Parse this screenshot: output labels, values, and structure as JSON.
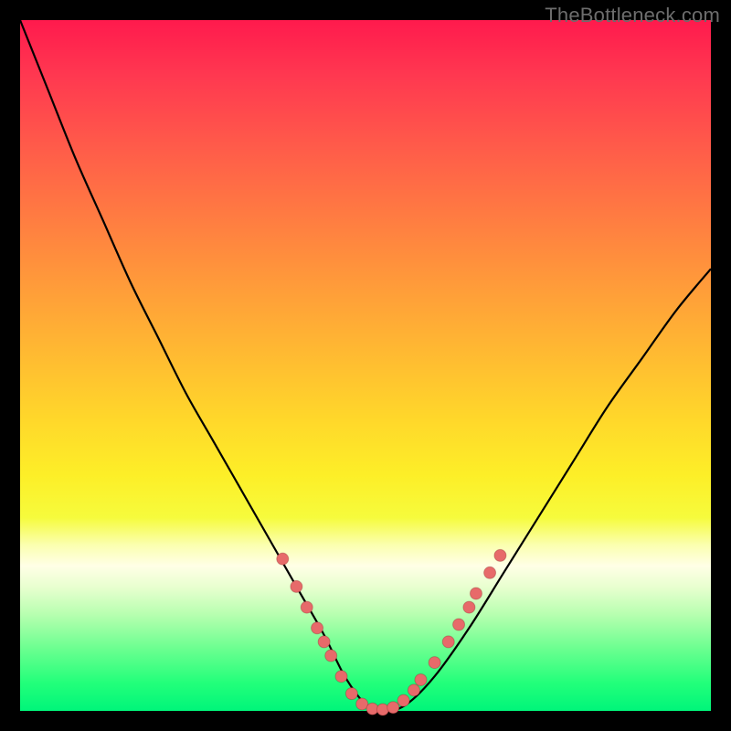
{
  "watermark": "TheBottleneck.com",
  "colors": {
    "curve": "#000000",
    "dots": "#e76a6a",
    "frame_bg_top": "#ff1a4d",
    "frame_bg_bottom": "#00f57a",
    "page_bg": "#000000"
  },
  "chart_data": {
    "type": "line",
    "title": "",
    "xlabel": "",
    "ylabel": "",
    "xlim": [
      0,
      100
    ],
    "ylim": [
      0,
      100
    ],
    "note": "Values estimated from pixel positions; axes have no tick labels.",
    "series": [
      {
        "name": "bottleneck-curve",
        "x": [
          0,
          4,
          8,
          12,
          16,
          20,
          24,
          28,
          32,
          36,
          40,
          44,
          47,
          50,
          53,
          56,
          60,
          65,
          70,
          75,
          80,
          85,
          90,
          95,
          100
        ],
        "y": [
          100,
          90,
          80,
          71,
          62,
          54,
          46,
          39,
          32,
          25,
          18,
          11,
          5,
          1,
          0,
          1,
          5,
          12,
          20,
          28,
          36,
          44,
          51,
          58,
          64
        ]
      }
    ],
    "dots": {
      "name": "highlighted-points",
      "points": [
        {
          "x": 38,
          "y": 22
        },
        {
          "x": 40,
          "y": 18
        },
        {
          "x": 41.5,
          "y": 15
        },
        {
          "x": 43,
          "y": 12
        },
        {
          "x": 44,
          "y": 10
        },
        {
          "x": 45,
          "y": 8
        },
        {
          "x": 46.5,
          "y": 5
        },
        {
          "x": 48,
          "y": 2.5
        },
        {
          "x": 49.5,
          "y": 1
        },
        {
          "x": 51,
          "y": 0.3
        },
        {
          "x": 52.5,
          "y": 0.2
        },
        {
          "x": 54,
          "y": 0.5
        },
        {
          "x": 55.5,
          "y": 1.5
        },
        {
          "x": 57,
          "y": 3
        },
        {
          "x": 58,
          "y": 4.5
        },
        {
          "x": 60,
          "y": 7
        },
        {
          "x": 62,
          "y": 10
        },
        {
          "x": 63.5,
          "y": 12.5
        },
        {
          "x": 65,
          "y": 15
        },
        {
          "x": 66,
          "y": 17
        },
        {
          "x": 68,
          "y": 20
        },
        {
          "x": 69.5,
          "y": 22.5
        }
      ]
    }
  }
}
